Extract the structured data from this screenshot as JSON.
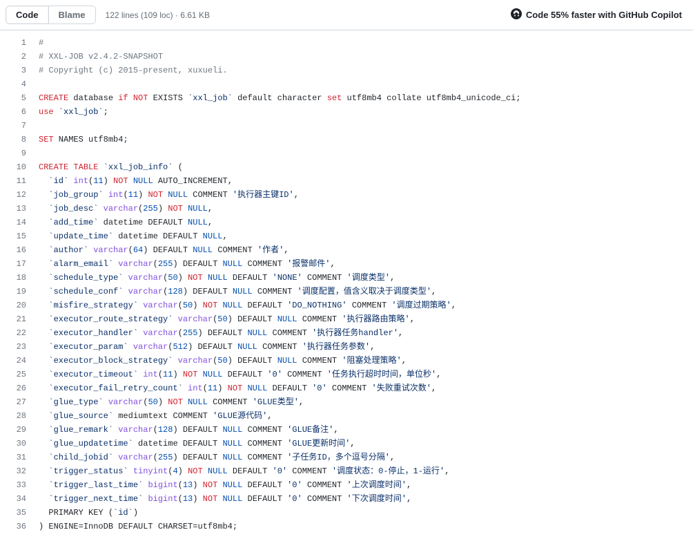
{
  "toolbar": {
    "code_label": "Code",
    "blame_label": "Blame",
    "meta": "122 lines (109 loc) · 6.61 KB",
    "copilot_label": "Code 55% faster with GitHub Copilot"
  },
  "lines": [
    [
      {
        "t": "#",
        "c": "cmt"
      }
    ],
    [
      {
        "t": "# XXL-JOB v2.4.2-SNAPSHOT",
        "c": "cmt"
      }
    ],
    [
      {
        "t": "# Copyright (c) 2015-present, xuxueli.",
        "c": "cmt"
      }
    ],
    [],
    [
      {
        "t": "CREATE",
        "c": "kw"
      },
      {
        "t": " database "
      },
      {
        "t": "if",
        "c": "kw"
      },
      {
        "t": " "
      },
      {
        "t": "NOT",
        "c": "kw"
      },
      {
        "t": " EXISTS "
      },
      {
        "t": "`xxl_job`",
        "c": "str"
      },
      {
        "t": " default character "
      },
      {
        "t": "set",
        "c": "kw"
      },
      {
        "t": " utf8mb4 collate utf8mb4_unicode_ci"
      },
      {
        "t": ";"
      }
    ],
    [
      {
        "t": "use",
        "c": "kw"
      },
      {
        "t": " "
      },
      {
        "t": "`xxl_job`",
        "c": "str"
      },
      {
        "t": ";"
      }
    ],
    [],
    [
      {
        "t": "SET",
        "c": "kw"
      },
      {
        "t": " NAMES utf8mb4"
      },
      {
        "t": ";"
      }
    ],
    [],
    [
      {
        "t": "CREATE",
        "c": "kw"
      },
      {
        "t": " "
      },
      {
        "t": "TABLE",
        "c": "kw"
      },
      {
        "t": " "
      },
      {
        "t": "`xxl_job_info`",
        "c": "str"
      },
      {
        "t": " ("
      }
    ],
    [
      {
        "t": "  "
      },
      {
        "t": "`id`",
        "c": "str"
      },
      {
        "t": " "
      },
      {
        "t": "int",
        "c": "fn"
      },
      {
        "t": "("
      },
      {
        "t": "11",
        "c": "num"
      },
      {
        "t": ") "
      },
      {
        "t": "NOT",
        "c": "kw"
      },
      {
        "t": " "
      },
      {
        "t": "NULL",
        "c": "null"
      },
      {
        "t": " AUTO_INCREMENT,"
      }
    ],
    [
      {
        "t": "  "
      },
      {
        "t": "`job_group`",
        "c": "str"
      },
      {
        "t": " "
      },
      {
        "t": "int",
        "c": "fn"
      },
      {
        "t": "("
      },
      {
        "t": "11",
        "c": "num"
      },
      {
        "t": ") "
      },
      {
        "t": "NOT",
        "c": "kw"
      },
      {
        "t": " "
      },
      {
        "t": "NULL",
        "c": "null"
      },
      {
        "t": " COMMENT "
      },
      {
        "t": "'执行器主键ID'",
        "c": "str"
      },
      {
        "t": ","
      }
    ],
    [
      {
        "t": "  "
      },
      {
        "t": "`job_desc`",
        "c": "str"
      },
      {
        "t": " "
      },
      {
        "t": "varchar",
        "c": "fn"
      },
      {
        "t": "("
      },
      {
        "t": "255",
        "c": "num"
      },
      {
        "t": ") "
      },
      {
        "t": "NOT",
        "c": "kw"
      },
      {
        "t": " "
      },
      {
        "t": "NULL",
        "c": "null"
      },
      {
        "t": ","
      }
    ],
    [
      {
        "t": "  "
      },
      {
        "t": "`add_time`",
        "c": "str"
      },
      {
        "t": " datetime DEFAULT "
      },
      {
        "t": "NULL",
        "c": "null"
      },
      {
        "t": ","
      }
    ],
    [
      {
        "t": "  "
      },
      {
        "t": "`update_time`",
        "c": "str"
      },
      {
        "t": " datetime DEFAULT "
      },
      {
        "t": "NULL",
        "c": "null"
      },
      {
        "t": ","
      }
    ],
    [
      {
        "t": "  "
      },
      {
        "t": "`author`",
        "c": "str"
      },
      {
        "t": " "
      },
      {
        "t": "varchar",
        "c": "fn"
      },
      {
        "t": "("
      },
      {
        "t": "64",
        "c": "num"
      },
      {
        "t": ") DEFAULT "
      },
      {
        "t": "NULL",
        "c": "null"
      },
      {
        "t": " COMMENT "
      },
      {
        "t": "'作者'",
        "c": "str"
      },
      {
        "t": ","
      }
    ],
    [
      {
        "t": "  "
      },
      {
        "t": "`alarm_email`",
        "c": "str"
      },
      {
        "t": " "
      },
      {
        "t": "varchar",
        "c": "fn"
      },
      {
        "t": "("
      },
      {
        "t": "255",
        "c": "num"
      },
      {
        "t": ") DEFAULT "
      },
      {
        "t": "NULL",
        "c": "null"
      },
      {
        "t": " COMMENT "
      },
      {
        "t": "'报警邮件'",
        "c": "str"
      },
      {
        "t": ","
      }
    ],
    [
      {
        "t": "  "
      },
      {
        "t": "`schedule_type`",
        "c": "str"
      },
      {
        "t": " "
      },
      {
        "t": "varchar",
        "c": "fn"
      },
      {
        "t": "("
      },
      {
        "t": "50",
        "c": "num"
      },
      {
        "t": ") "
      },
      {
        "t": "NOT",
        "c": "kw"
      },
      {
        "t": " "
      },
      {
        "t": "NULL",
        "c": "null"
      },
      {
        "t": " DEFAULT "
      },
      {
        "t": "'NONE'",
        "c": "str"
      },
      {
        "t": " COMMENT "
      },
      {
        "t": "'调度类型'",
        "c": "str"
      },
      {
        "t": ","
      }
    ],
    [
      {
        "t": "  "
      },
      {
        "t": "`schedule_conf`",
        "c": "str"
      },
      {
        "t": " "
      },
      {
        "t": "varchar",
        "c": "fn"
      },
      {
        "t": "("
      },
      {
        "t": "128",
        "c": "num"
      },
      {
        "t": ") DEFAULT "
      },
      {
        "t": "NULL",
        "c": "null"
      },
      {
        "t": " COMMENT "
      },
      {
        "t": "'调度配置，值含义取决于调度类型'",
        "c": "str"
      },
      {
        "t": ","
      }
    ],
    [
      {
        "t": "  "
      },
      {
        "t": "`misfire_strategy`",
        "c": "str"
      },
      {
        "t": " "
      },
      {
        "t": "varchar",
        "c": "fn"
      },
      {
        "t": "("
      },
      {
        "t": "50",
        "c": "num"
      },
      {
        "t": ") "
      },
      {
        "t": "NOT",
        "c": "kw"
      },
      {
        "t": " "
      },
      {
        "t": "NULL",
        "c": "null"
      },
      {
        "t": " DEFAULT "
      },
      {
        "t": "'DO_NOTHING'",
        "c": "str"
      },
      {
        "t": " COMMENT "
      },
      {
        "t": "'调度过期策略'",
        "c": "str"
      },
      {
        "t": ","
      }
    ],
    [
      {
        "t": "  "
      },
      {
        "t": "`executor_route_strategy`",
        "c": "str"
      },
      {
        "t": " "
      },
      {
        "t": "varchar",
        "c": "fn"
      },
      {
        "t": "("
      },
      {
        "t": "50",
        "c": "num"
      },
      {
        "t": ") DEFAULT "
      },
      {
        "t": "NULL",
        "c": "null"
      },
      {
        "t": " COMMENT "
      },
      {
        "t": "'执行器路由策略'",
        "c": "str"
      },
      {
        "t": ","
      }
    ],
    [
      {
        "t": "  "
      },
      {
        "t": "`executor_handler`",
        "c": "str"
      },
      {
        "t": " "
      },
      {
        "t": "varchar",
        "c": "fn"
      },
      {
        "t": "("
      },
      {
        "t": "255",
        "c": "num"
      },
      {
        "t": ") DEFAULT "
      },
      {
        "t": "NULL",
        "c": "null"
      },
      {
        "t": " COMMENT "
      },
      {
        "t": "'执行器任务handler'",
        "c": "str"
      },
      {
        "t": ","
      }
    ],
    [
      {
        "t": "  "
      },
      {
        "t": "`executor_param`",
        "c": "str"
      },
      {
        "t": " "
      },
      {
        "t": "varchar",
        "c": "fn"
      },
      {
        "t": "("
      },
      {
        "t": "512",
        "c": "num"
      },
      {
        "t": ") DEFAULT "
      },
      {
        "t": "NULL",
        "c": "null"
      },
      {
        "t": " COMMENT "
      },
      {
        "t": "'执行器任务参数'",
        "c": "str"
      },
      {
        "t": ","
      }
    ],
    [
      {
        "t": "  "
      },
      {
        "t": "`executor_block_strategy`",
        "c": "str"
      },
      {
        "t": " "
      },
      {
        "t": "varchar",
        "c": "fn"
      },
      {
        "t": "("
      },
      {
        "t": "50",
        "c": "num"
      },
      {
        "t": ") DEFAULT "
      },
      {
        "t": "NULL",
        "c": "null"
      },
      {
        "t": " COMMENT "
      },
      {
        "t": "'阻塞处理策略'",
        "c": "str"
      },
      {
        "t": ","
      }
    ],
    [
      {
        "t": "  "
      },
      {
        "t": "`executor_timeout`",
        "c": "str"
      },
      {
        "t": " "
      },
      {
        "t": "int",
        "c": "fn"
      },
      {
        "t": "("
      },
      {
        "t": "11",
        "c": "num"
      },
      {
        "t": ") "
      },
      {
        "t": "NOT",
        "c": "kw"
      },
      {
        "t": " "
      },
      {
        "t": "NULL",
        "c": "null"
      },
      {
        "t": " DEFAULT "
      },
      {
        "t": "'0'",
        "c": "str"
      },
      {
        "t": " COMMENT "
      },
      {
        "t": "'任务执行超时时间，单位秒'",
        "c": "str"
      },
      {
        "t": ","
      }
    ],
    [
      {
        "t": "  "
      },
      {
        "t": "`executor_fail_retry_count`",
        "c": "str"
      },
      {
        "t": " "
      },
      {
        "t": "int",
        "c": "fn"
      },
      {
        "t": "("
      },
      {
        "t": "11",
        "c": "num"
      },
      {
        "t": ") "
      },
      {
        "t": "NOT",
        "c": "kw"
      },
      {
        "t": " "
      },
      {
        "t": "NULL",
        "c": "null"
      },
      {
        "t": " DEFAULT "
      },
      {
        "t": "'0'",
        "c": "str"
      },
      {
        "t": " COMMENT "
      },
      {
        "t": "'失败重试次数'",
        "c": "str"
      },
      {
        "t": ","
      }
    ],
    [
      {
        "t": "  "
      },
      {
        "t": "`glue_type`",
        "c": "str"
      },
      {
        "t": " "
      },
      {
        "t": "varchar",
        "c": "fn"
      },
      {
        "t": "("
      },
      {
        "t": "50",
        "c": "num"
      },
      {
        "t": ") "
      },
      {
        "t": "NOT",
        "c": "kw"
      },
      {
        "t": " "
      },
      {
        "t": "NULL",
        "c": "null"
      },
      {
        "t": " COMMENT "
      },
      {
        "t": "'GLUE类型'",
        "c": "str"
      },
      {
        "t": ","
      }
    ],
    [
      {
        "t": "  "
      },
      {
        "t": "`glue_source`",
        "c": "str"
      },
      {
        "t": " mediumtext COMMENT "
      },
      {
        "t": "'GLUE源代码'",
        "c": "str"
      },
      {
        "t": ","
      }
    ],
    [
      {
        "t": "  "
      },
      {
        "t": "`glue_remark`",
        "c": "str"
      },
      {
        "t": " "
      },
      {
        "t": "varchar",
        "c": "fn"
      },
      {
        "t": "("
      },
      {
        "t": "128",
        "c": "num"
      },
      {
        "t": ") DEFAULT "
      },
      {
        "t": "NULL",
        "c": "null"
      },
      {
        "t": " COMMENT "
      },
      {
        "t": "'GLUE备注'",
        "c": "str"
      },
      {
        "t": ","
      }
    ],
    [
      {
        "t": "  "
      },
      {
        "t": "`glue_updatetime`",
        "c": "str"
      },
      {
        "t": " datetime DEFAULT "
      },
      {
        "t": "NULL",
        "c": "null"
      },
      {
        "t": " COMMENT "
      },
      {
        "t": "'GLUE更新时间'",
        "c": "str"
      },
      {
        "t": ","
      }
    ],
    [
      {
        "t": "  "
      },
      {
        "t": "`child_jobid`",
        "c": "str"
      },
      {
        "t": " "
      },
      {
        "t": "varchar",
        "c": "fn"
      },
      {
        "t": "("
      },
      {
        "t": "255",
        "c": "num"
      },
      {
        "t": ") DEFAULT "
      },
      {
        "t": "NULL",
        "c": "null"
      },
      {
        "t": " COMMENT "
      },
      {
        "t": "'子任务ID，多个逗号分隔'",
        "c": "str"
      },
      {
        "t": ","
      }
    ],
    [
      {
        "t": "  "
      },
      {
        "t": "`trigger_status`",
        "c": "str"
      },
      {
        "t": " "
      },
      {
        "t": "tinyint",
        "c": "fn"
      },
      {
        "t": "("
      },
      {
        "t": "4",
        "c": "num"
      },
      {
        "t": ") "
      },
      {
        "t": "NOT",
        "c": "kw"
      },
      {
        "t": " "
      },
      {
        "t": "NULL",
        "c": "null"
      },
      {
        "t": " DEFAULT "
      },
      {
        "t": "'0'",
        "c": "str"
      },
      {
        "t": " COMMENT "
      },
      {
        "t": "'调度状态：0-停止，1-运行'",
        "c": "str"
      },
      {
        "t": ","
      }
    ],
    [
      {
        "t": "  "
      },
      {
        "t": "`trigger_last_time`",
        "c": "str"
      },
      {
        "t": " "
      },
      {
        "t": "bigint",
        "c": "fn"
      },
      {
        "t": "("
      },
      {
        "t": "13",
        "c": "num"
      },
      {
        "t": ") "
      },
      {
        "t": "NOT",
        "c": "kw"
      },
      {
        "t": " "
      },
      {
        "t": "NULL",
        "c": "null"
      },
      {
        "t": " DEFAULT "
      },
      {
        "t": "'0'",
        "c": "str"
      },
      {
        "t": " COMMENT "
      },
      {
        "t": "'上次调度时间'",
        "c": "str"
      },
      {
        "t": ","
      }
    ],
    [
      {
        "t": "  "
      },
      {
        "t": "`trigger_next_time`",
        "c": "str"
      },
      {
        "t": " "
      },
      {
        "t": "bigint",
        "c": "fn"
      },
      {
        "t": "("
      },
      {
        "t": "13",
        "c": "num"
      },
      {
        "t": ") "
      },
      {
        "t": "NOT",
        "c": "kw"
      },
      {
        "t": " "
      },
      {
        "t": "NULL",
        "c": "null"
      },
      {
        "t": " DEFAULT "
      },
      {
        "t": "'0'",
        "c": "str"
      },
      {
        "t": " COMMENT "
      },
      {
        "t": "'下次调度时间'",
        "c": "str"
      },
      {
        "t": ","
      }
    ],
    [
      {
        "t": "  PRIMARY KEY ("
      },
      {
        "t": "`id`",
        "c": "str"
      },
      {
        "t": ")"
      }
    ],
    [
      {
        "t": ") ENGINE"
      },
      {
        "t": "="
      },
      {
        "t": "InnoDB DEFAULT CHARSET"
      },
      {
        "t": "="
      },
      {
        "t": "utf8mb4;"
      }
    ]
  ]
}
